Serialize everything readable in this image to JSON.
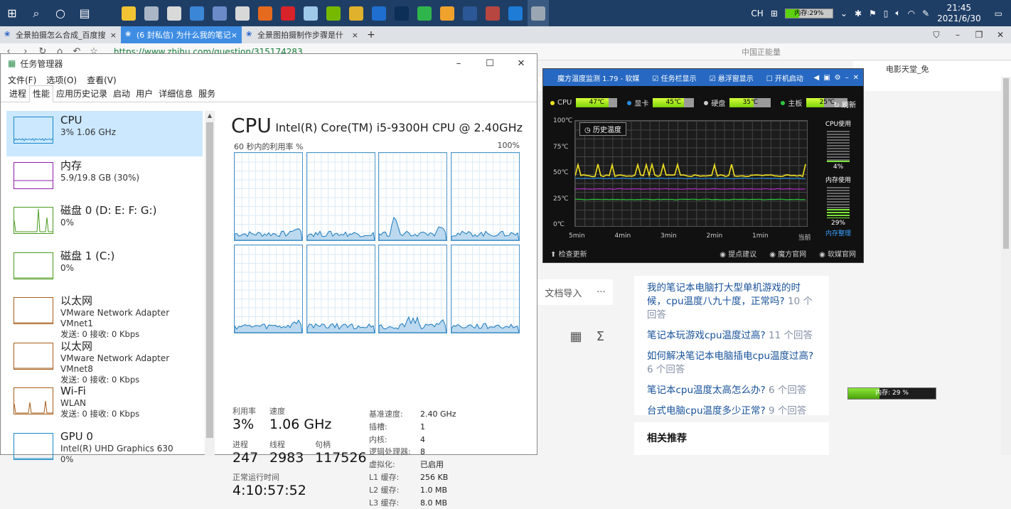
{
  "taskbar": {
    "ime_label": "CH",
    "mem_badge": "内存:29%",
    "clock_time": "21:45",
    "clock_date": "2021/6/30",
    "apps": [
      {
        "name": "folder-app-icon",
        "color": "#f2c433"
      },
      {
        "name": "pc-app-icon",
        "color": "#aab6c6"
      },
      {
        "name": "clock-app-icon",
        "color": "#d9d9d9"
      },
      {
        "name": "mail-app-icon",
        "color": "#3b86d6"
      },
      {
        "name": "server-app-icon",
        "color": "#6a8bc8"
      },
      {
        "name": "plane-app-icon",
        "color": "#d8d8d8"
      },
      {
        "name": "firefox-app-icon",
        "color": "#e66a1e"
      },
      {
        "name": "opera-app-icon",
        "color": "#d8232a"
      },
      {
        "name": "notes-app-icon",
        "color": "#9ec9e8"
      },
      {
        "name": "nvidia-app-icon",
        "color": "#76b900"
      },
      {
        "name": "chrome-app-icon",
        "color": "#e0b12c"
      },
      {
        "name": "bluetooth-app-icon",
        "color": "#1f6fd1"
      },
      {
        "name": "photoshop-app-icon",
        "color": "#0b2f57"
      },
      {
        "name": "wechat-app-icon",
        "color": "#2fb54b"
      },
      {
        "name": "video-app-icon",
        "color": "#f0a22d"
      },
      {
        "name": "word-app-icon",
        "color": "#2b5797"
      },
      {
        "name": "people-app-icon",
        "color": "#b6463f"
      },
      {
        "name": "edge-app-icon",
        "color": "#1e7bd6"
      },
      {
        "name": "tempmon-app-icon",
        "color": "#9aa6b2"
      }
    ]
  },
  "browser": {
    "tabs": [
      {
        "label": "全景拍摄怎么合成_百度搜",
        "active": false
      },
      {
        "label": "(6 封私信) 为什么我的笔记",
        "active": true
      },
      {
        "label": "全景图拍摄制作步骤是什",
        "active": false
      }
    ],
    "url": "https://www.zhihu.com/question/315174283",
    "brand": "中国正能量",
    "bookmark": "电影天堂_免"
  },
  "task_manager": {
    "title": "任务管理器",
    "menu": [
      "文件(F)",
      "选项(O)",
      "查看(V)"
    ],
    "tabs": [
      "进程",
      "性能",
      "应用历史记录",
      "启动",
      "用户",
      "详细信息",
      "服务"
    ],
    "resources": [
      {
        "title": "CPU",
        "line2": "3% 1.06 GHz",
        "line3": "",
        "color": "#1a8ac7"
      },
      {
        "title": "内存",
        "line2": "5.9/19.8 GB (30%)",
        "line3": "",
        "color": "#8b1fa8"
      },
      {
        "title": "磁盘 0 (D: E: F: G:)",
        "line2": "0%",
        "line3": "",
        "color": "#4b9b1f"
      },
      {
        "title": "磁盘 1 (C:)",
        "line2": "0%",
        "line3": "",
        "color": "#4b9b1f"
      },
      {
        "title": "以太网",
        "line2": "VMware Network Adapter VMnet1",
        "line3": "发送: 0 接收: 0 Kbps",
        "color": "#a65c1a"
      },
      {
        "title": "以太网",
        "line2": "VMware Network Adapter VMnet8",
        "line3": "发送: 0 接收: 0 Kbps",
        "color": "#a65c1a"
      },
      {
        "title": "Wi-Fi",
        "line2": "WLAN",
        "line3": "发送: 0 接收: 0 Kbps",
        "color": "#a65c1a"
      },
      {
        "title": "GPU 0",
        "line2": "Intel(R) UHD Graphics 630",
        "line3": "0%",
        "color": "#1a8ac7"
      }
    ],
    "cpu": {
      "heading": "CPU",
      "model": "Intel(R) Core(TM) i5-9300H CPU @ 2.40GHz",
      "graph_label": "60 秒内的利用率 %",
      "graph_max": "100%",
      "stats": {
        "util_label": "利用率",
        "util_value": "3%",
        "speed_label": "速度",
        "speed_value": "1.06 GHz",
        "proc_label": "进程",
        "proc_value": "247",
        "thread_label": "线程",
        "thread_value": "2983",
        "handle_label": "句柄",
        "handle_value": "117526",
        "uptime_label": "正常运行时间",
        "uptime_value": "4:10:57:52"
      },
      "specs": [
        {
          "k": "基准速度:",
          "v": "2.40 GHz"
        },
        {
          "k": "插槽:",
          "v": "1"
        },
        {
          "k": "内核:",
          "v": "4"
        },
        {
          "k": "逻辑处理器:",
          "v": "8"
        },
        {
          "k": "虚拟化:",
          "v": "已启用"
        },
        {
          "k": "L1 缓存:",
          "v": "256 KB"
        },
        {
          "k": "L2 缓存:",
          "v": "1.0 MB"
        },
        {
          "k": "L3 缓存:",
          "v": "8.0 MB"
        }
      ]
    }
  },
  "temp_monitor": {
    "title": "魔方温度监测 1.79 - 软媒",
    "checks": [
      "任务栏显示",
      "悬浮窗显示",
      "开机启动"
    ],
    "sensors": [
      {
        "label": "CPU",
        "value": "47℃",
        "color": "#f0e020"
      },
      {
        "label": "显卡",
        "value": "45℃",
        "color": "#2a8fe0"
      },
      {
        "label": "硬盘",
        "value": "35℃",
        "color": "#cccccc"
      },
      {
        "label": "主板",
        "value": "25℃",
        "color": "#2dc93a"
      }
    ],
    "refresh": "刷新",
    "history_btn": "历史温度",
    "y_ticks": [
      "100℃",
      "75℃",
      "50℃",
      "25℃",
      "0℃"
    ],
    "x_ticks": [
      "5min",
      "4min",
      "3min",
      "2min",
      "1min",
      "当前"
    ],
    "cpu_usage_label": "CPU使用",
    "cpu_usage_value": "4%",
    "mem_usage_label": "内存使用",
    "mem_usage_value": "29%",
    "mem_clean": "内存整理",
    "foot_left": "检查更新",
    "foot_right": [
      "提点建议",
      "魔方官网",
      "软媒官网"
    ]
  },
  "zhihu": {
    "mid_label": "文档导入",
    "questions": [
      {
        "text": "我的笔记本电脑打大型单机游戏的时候，cpu温度八九十度，正常吗?",
        "count": "10 个回答"
      },
      {
        "text": "笔记本玩游戏cpu温度过高?",
        "count": "11 个回答"
      },
      {
        "text": "如何解决笔记本电脑插电cpu温度过高?",
        "count": "6 个回答"
      },
      {
        "text": "笔记本cpu温度太高怎么办?",
        "count": "6 个回答"
      },
      {
        "text": "台式电脑cpu温度多少正常?",
        "count": "9 个回答"
      }
    ],
    "recommend": "相关推荐",
    "mem_widget": "内存: 29 %"
  }
}
